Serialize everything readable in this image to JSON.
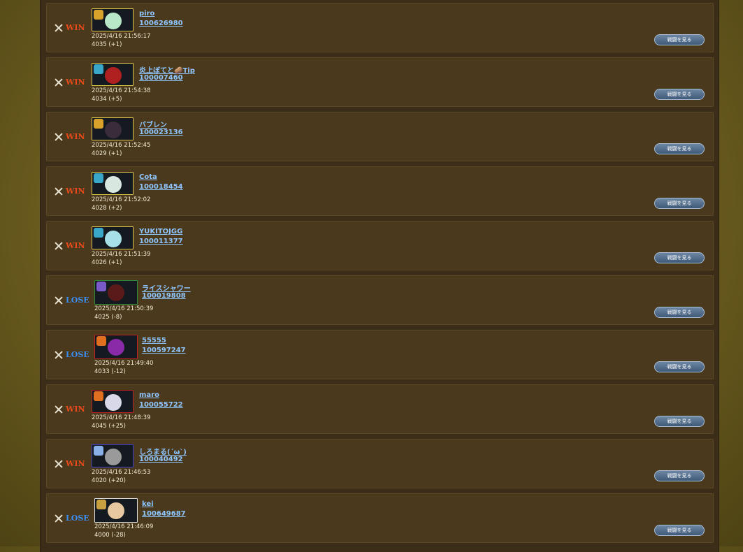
{
  "button_label": "戦闘を見る",
  "win_label": "WIN",
  "lose_label": "LOSE",
  "battles": [
    {
      "result": "win",
      "name": "piro",
      "uid": "100626980",
      "date": "2025/4/16 21:56:17",
      "rating": "4035 (+1)",
      "frame": "#e0c84a",
      "badge": "#d9a22b",
      "face": "#b8e8c8"
    },
    {
      "result": "win",
      "name": "炎上ぼてと🥔Tip",
      "uid": "100007460",
      "date": "2025/4/16 21:54:38",
      "rating": "4034 (+5)",
      "frame": "#e0c84a",
      "badge": "#3aa6c8",
      "face": "#b02020"
    },
    {
      "result": "win",
      "name": "バブレン",
      "uid": "100023136",
      "date": "2025/4/16 21:52:45",
      "rating": "4029 (+1)",
      "frame": "#e0c84a",
      "badge": "#d9a22b",
      "face": "#3a2c3a"
    },
    {
      "result": "win",
      "name": "Cota",
      "uid": "100018454",
      "date": "2025/4/16 21:52:02",
      "rating": "4028 (+2)",
      "frame": "#e0c84a",
      "badge": "#3aa6c8",
      "face": "#d8e8e0"
    },
    {
      "result": "win",
      "name": "YUKITOJGG",
      "uid": "100011377",
      "date": "2025/4/16 21:51:39",
      "rating": "4026 (+1)",
      "frame": "#e0c84a",
      "badge": "#3aa6c8",
      "face": "#a8e0e8"
    },
    {
      "result": "lose",
      "name": "ライスシャワー",
      "uid": "100019808",
      "date": "2025/4/16 21:50:39",
      "rating": "4025 (-8)",
      "frame": "#2f8a3a",
      "badge": "#7a5ac8",
      "face": "#5a1a1a"
    },
    {
      "result": "lose",
      "name": "55555",
      "uid": "100597247",
      "date": "2025/4/16 21:49:40",
      "rating": "4033 (-12)",
      "frame": "#c02020",
      "badge": "#e07020",
      "face": "#8a2aa8"
    },
    {
      "result": "win",
      "name": "maro",
      "uid": "100055722",
      "date": "2025/4/16 21:48:39",
      "rating": "4045 (+25)",
      "frame": "#c02020",
      "badge": "#e07020",
      "face": "#d8d8e8"
    },
    {
      "result": "win",
      "name": "しろまる(ˊωˋ)",
      "uid": "100040492",
      "date": "2025/4/16 21:46:53",
      "rating": "4020 (+20)",
      "frame": "#3a3ad0",
      "badge": "#8ab0e8",
      "face": "#9a9a9a"
    },
    {
      "result": "lose",
      "name": "kei",
      "uid": "100649687",
      "date": "2025/4/16 21:46:09",
      "rating": "4000 (-28)",
      "frame": "#e0e0e0",
      "badge": "#c8a040",
      "face": "#e8c8a0"
    }
  ]
}
